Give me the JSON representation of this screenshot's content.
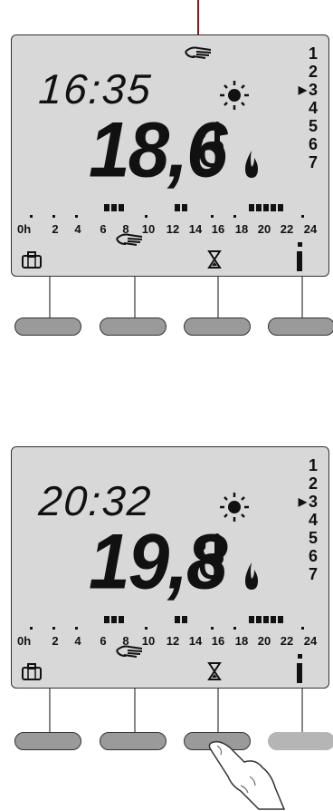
{
  "panels": [
    {
      "time": "16:35",
      "temperature": "18,6",
      "unit": "C",
      "programs": [
        "1",
        "2",
        "3",
        "4",
        "5",
        "6",
        "7"
      ],
      "selected_program": "3",
      "hour_labels": [
        "0h",
        "2",
        "4",
        "6",
        "8",
        "10",
        "12",
        "14",
        "16",
        "18",
        "20",
        "22",
        "24"
      ],
      "manual_hand_top": true,
      "pressed_button": null
    },
    {
      "time": "20:32",
      "temperature": "19,8",
      "unit": "C",
      "programs": [
        "1",
        "2",
        "3",
        "4",
        "5",
        "6",
        "7"
      ],
      "selected_program": "3",
      "hour_labels": [
        "0h",
        "2",
        "4",
        "6",
        "8",
        "10",
        "12",
        "14",
        "16",
        "18",
        "20",
        "22",
        "24"
      ],
      "manual_hand_top": false,
      "pressed_button": "hourglass"
    }
  ],
  "icons": {
    "sun": "sun-icon",
    "thermometer": "thermometer-icon",
    "flame": "flame-icon",
    "hand": "hand-icon",
    "suitcase": "suitcase-icon",
    "hourglass": "hourglass-icon",
    "info": "info-icon",
    "finger": "finger-icon"
  },
  "colors": {
    "lcd_background": "#d8d8d8",
    "button": "#9a9a9a",
    "button_light": "#b5b5b5",
    "marker": "#8b1a1a"
  }
}
